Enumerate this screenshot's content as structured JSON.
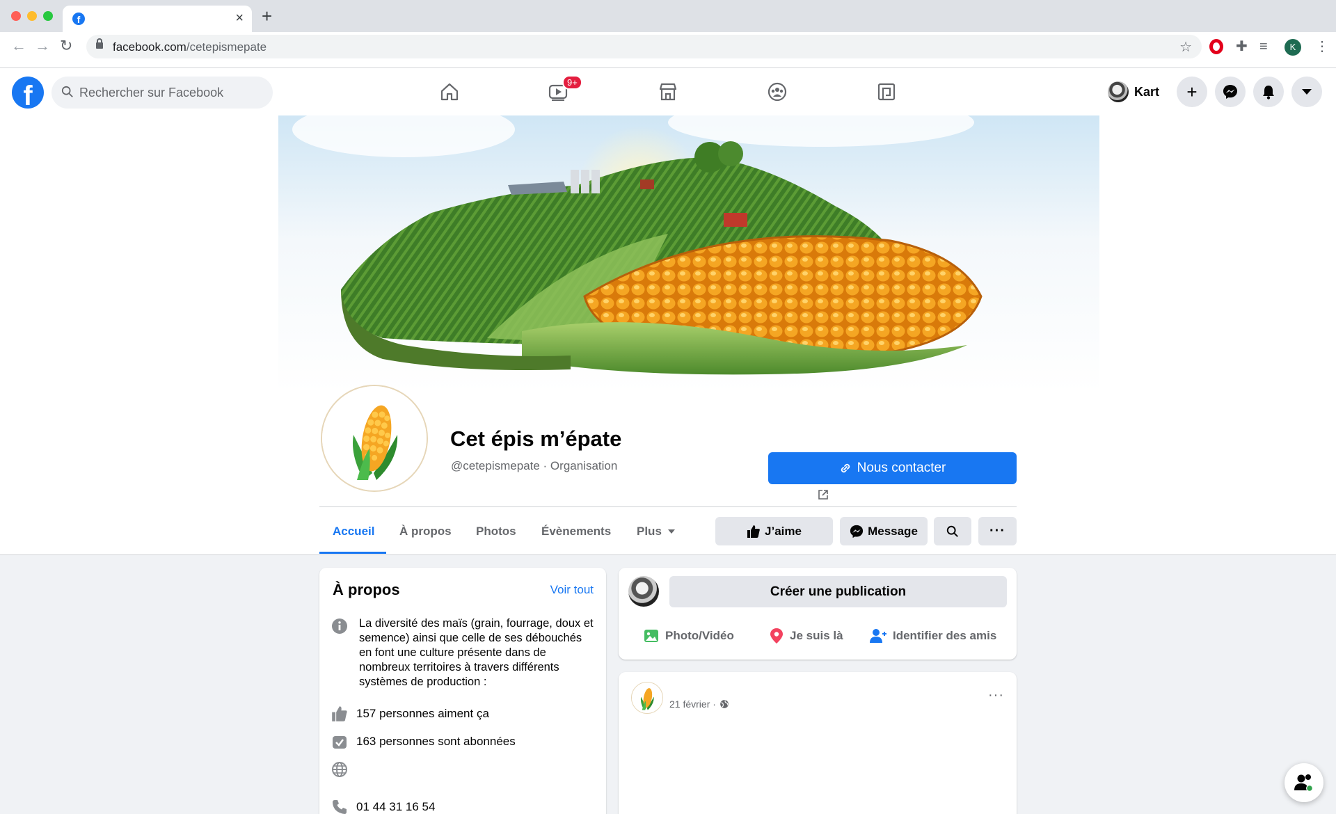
{
  "browser": {
    "tab_title": "",
    "url_host": "facebook.com",
    "url_path": "/cetepismepate",
    "profile_initial": "K"
  },
  "fb": {
    "search_placeholder": "Rechercher sur Facebook",
    "watch_badge": "9+",
    "user_name": "Kart"
  },
  "page": {
    "name": "Cet épis m’épate",
    "handle": "@cetepismepate · Organisation",
    "contact_label": "Nous contacter",
    "tabs": [
      {
        "label": "Accueil",
        "active": true
      },
      {
        "label": "À propos",
        "active": false
      },
      {
        "label": "Photos",
        "active": false
      },
      {
        "label": "Évènements",
        "active": false
      },
      {
        "label": "Plus",
        "active": false
      }
    ],
    "like_label": "J’aime",
    "message_label": "Message"
  },
  "about": {
    "title": "À propos",
    "see_all": "Voir tout",
    "description": "La diversité des maïs (grain, fourrage, doux et semence) ainsi que celle de ses débouchés en font une culture présente dans de nombreux territoires à travers différents systèmes de production :",
    "likes": "157 personnes aiment ça",
    "followers": "163 personnes sont abonnées",
    "phone": "01 44 31 16 54"
  },
  "composer": {
    "create_label": "Créer une publication",
    "photo_label": "Photo/Vidéo",
    "checkin_label": "Je suis là",
    "tag_label": "Identifier des amis"
  },
  "post": {
    "date": "21 février ·"
  },
  "colors": {
    "brand": "#1877f2",
    "badge": "#e41e3f"
  }
}
